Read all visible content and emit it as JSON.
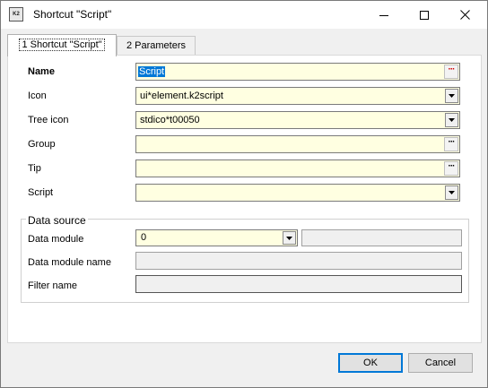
{
  "window": {
    "title": "Shortcut \"Script\"",
    "app_icon_text": "K2"
  },
  "tabs": [
    {
      "label": "1 Shortcut \"Script\""
    },
    {
      "label": "2 Parameters"
    }
  ],
  "fields": {
    "name": {
      "label": "Name",
      "value": "Script"
    },
    "icon": {
      "label": "Icon",
      "value": "ui*element.k2script"
    },
    "tree_icon": {
      "label": "Tree icon",
      "value": "stdico*t00050"
    },
    "group": {
      "label": "Group",
      "value": ""
    },
    "tip": {
      "label": "Tip",
      "value": ""
    },
    "script": {
      "label": "Script",
      "value": ""
    }
  },
  "data_source": {
    "title": "Data source",
    "data_module": {
      "label": "Data module",
      "value": "0",
      "extra": ""
    },
    "data_module_name": {
      "label": "Data module name",
      "value": ""
    },
    "filter_name": {
      "label": "Filter name",
      "value": ""
    }
  },
  "buttons": {
    "ok": "OK",
    "cancel": "Cancel"
  }
}
